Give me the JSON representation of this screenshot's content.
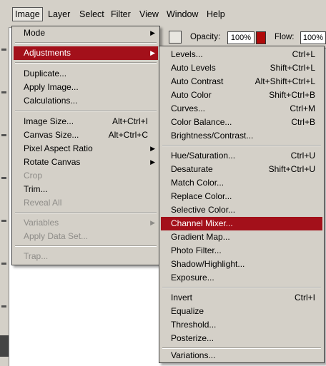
{
  "menubar": {
    "items": [
      "Image",
      "Layer",
      "Select",
      "Filter",
      "View",
      "Window",
      "Help"
    ]
  },
  "options_bar": {
    "opacity_label": "Opacity:",
    "opacity_value": "100%",
    "flow_label": "Flow:",
    "flow_value": "100%"
  },
  "image_menu": {
    "items": [
      {
        "label": "Mode",
        "submenu": true
      },
      {
        "label": "Adjustments",
        "submenu": true,
        "highlighted": true
      },
      {
        "label": "Duplicate..."
      },
      {
        "label": "Apply Image..."
      },
      {
        "label": "Calculations..."
      },
      {
        "label": "Image Size...",
        "shortcut": "Alt+Ctrl+I"
      },
      {
        "label": "Canvas Size...",
        "shortcut": "Alt+Ctrl+C"
      },
      {
        "label": "Pixel Aspect Ratio",
        "submenu": true
      },
      {
        "label": "Rotate Canvas",
        "submenu": true
      },
      {
        "label": "Crop",
        "disabled": true
      },
      {
        "label": "Trim..."
      },
      {
        "label": "Reveal All",
        "disabled": true
      },
      {
        "label": "Variables",
        "submenu": true,
        "disabled": true
      },
      {
        "label": "Apply Data Set...",
        "disabled": true
      },
      {
        "label": "Trap...",
        "disabled": true
      }
    ]
  },
  "adjustments_menu": {
    "items": [
      {
        "label": "Levels...",
        "shortcut": "Ctrl+L"
      },
      {
        "label": "Auto Levels",
        "shortcut": "Shift+Ctrl+L"
      },
      {
        "label": "Auto Contrast",
        "shortcut": "Alt+Shift+Ctrl+L"
      },
      {
        "label": "Auto Color",
        "shortcut": "Shift+Ctrl+B"
      },
      {
        "label": "Curves...",
        "shortcut": "Ctrl+M"
      },
      {
        "label": "Color Balance...",
        "shortcut": "Ctrl+B"
      },
      {
        "label": "Brightness/Contrast..."
      },
      {
        "label": "Hue/Saturation...",
        "shortcut": "Ctrl+U"
      },
      {
        "label": "Desaturate",
        "shortcut": "Shift+Ctrl+U"
      },
      {
        "label": "Match Color..."
      },
      {
        "label": "Replace Color..."
      },
      {
        "label": "Selective Color..."
      },
      {
        "label": "Channel Mixer...",
        "highlighted": true
      },
      {
        "label": "Gradient Map..."
      },
      {
        "label": "Photo Filter..."
      },
      {
        "label": "Shadow/Highlight..."
      },
      {
        "label": "Exposure..."
      },
      {
        "label": "Invert",
        "shortcut": "Ctrl+I"
      },
      {
        "label": "Equalize"
      },
      {
        "label": "Threshold..."
      },
      {
        "label": "Posterize..."
      },
      {
        "label": "Variations..."
      }
    ]
  },
  "colors": {
    "highlight": "#a3101a",
    "menu_bg": "#d4d0c8"
  }
}
